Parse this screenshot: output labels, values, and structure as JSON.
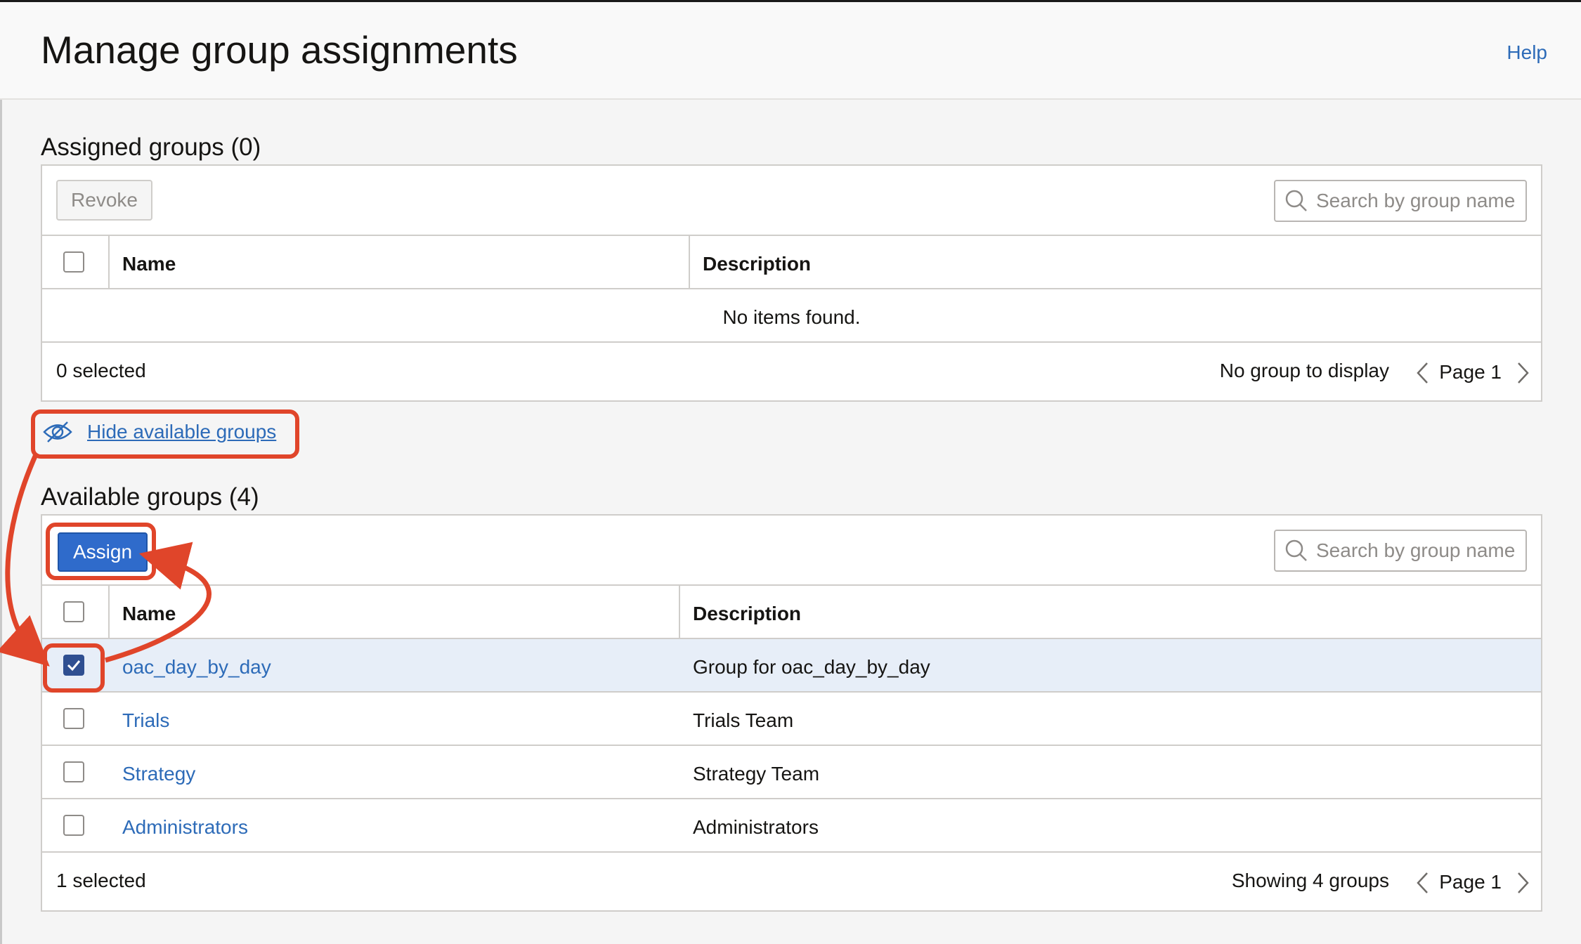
{
  "header": {
    "title": "Manage group assignments",
    "help_label": "Help"
  },
  "assigned": {
    "title": "Assigned groups (0)",
    "revoke_label": "Revoke",
    "search_placeholder": "Search by group name",
    "col_name": "Name",
    "col_description": "Description",
    "empty_message": "No items found.",
    "selected_count": "0 selected",
    "status_text": "No group to display",
    "page_label": "Page 1"
  },
  "toggle": {
    "hide_label": "Hide available groups"
  },
  "available": {
    "title": "Available groups (4)",
    "assign_label": "Assign",
    "search_placeholder": "Search by group name",
    "col_name": "Name",
    "col_description": "Description",
    "rows": [
      {
        "name": "oac_day_by_day",
        "description": "Group for oac_day_by_day",
        "checked": true
      },
      {
        "name": "Trials",
        "description": "Trials Team",
        "checked": false
      },
      {
        "name": "Strategy",
        "description": "Strategy Team",
        "checked": false
      },
      {
        "name": "Administrators",
        "description": "Administrators",
        "checked": false
      }
    ],
    "selected_count": "1 selected",
    "status_text": "Showing 4 groups",
    "page_label": "Page 1"
  },
  "colors": {
    "accent": "#2f6bcb",
    "link": "#2d6bb8",
    "annotation": "#e0452a",
    "selected_row": "#e7eef8"
  },
  "icons": [
    "search-icon",
    "eye-slash-icon",
    "chevron-left-icon",
    "chevron-right-icon",
    "checkmark-icon"
  ]
}
